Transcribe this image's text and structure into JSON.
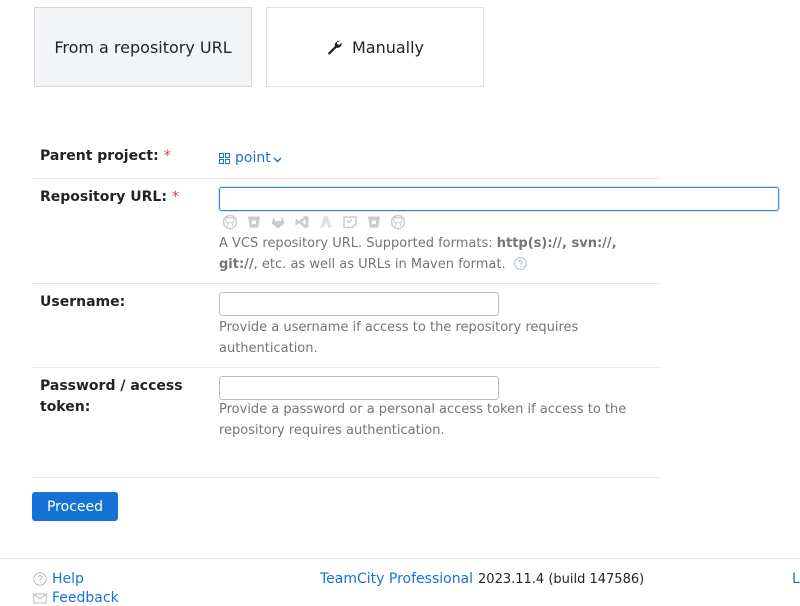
{
  "mode_tabs": {
    "from_repository": "From a repository URL",
    "manually": "Manually"
  },
  "form": {
    "parent_project": {
      "label": "Parent project:",
      "required_mark": "*",
      "value": "point"
    },
    "repository_url": {
      "label": "Repository URL:",
      "required_mark": "*",
      "value": "",
      "vcs_icons": [
        "github-icon",
        "bitbucket-icon",
        "gitlab-icon",
        "visual-studio-icon",
        "azure-devops-icon",
        "codecommit-icon",
        "bitbucket-server-icon",
        "github-enterprise-icon"
      ],
      "hint_prefix": "A VCS repository URL. Supported formats: ",
      "hint_formats": "http(s)://, svn://, git://",
      "hint_suffix": ", etc. as well as URLs in Maven format."
    },
    "username": {
      "label": "Username:",
      "value": "",
      "hint": "Provide a username if access to the repository requires authentication."
    },
    "password": {
      "label": "Password / access token:",
      "value": "",
      "hint": "Provide a password or a personal access token if access to the repository requires authentication."
    },
    "proceed_label": "Proceed"
  },
  "footer": {
    "help": "Help",
    "feedback": "Feedback",
    "product": "TeamCity Professional",
    "version": "2023.11.4 (build 147586)",
    "edge_text": "L"
  },
  "colors": {
    "accent": "#1673d6",
    "required": "#e23c3c",
    "hint": "#737577"
  }
}
